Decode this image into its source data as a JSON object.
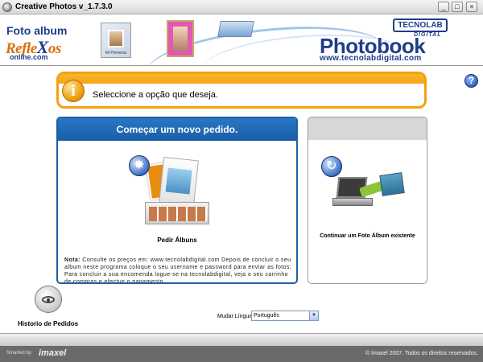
{
  "window": {
    "title": "Creative Photos v_1.7.3.0",
    "minimize_label": "_",
    "maximize_label": "□",
    "close_label": "×"
  },
  "header": {
    "logo_line1": "Foto album",
    "logo_line2_a": "Refle",
    "logo_line2_x": "X",
    "logo_line2_b": "os",
    "logo_line3": "online.com",
    "thumb1_caption": "Mi Primeras",
    "brand_title": "Photobook",
    "brand_url": "www.tecnolabdigital.com",
    "tecnolab_logo": "TECNOLAB",
    "tecnolab_sub": "DIGITAL"
  },
  "help": {
    "label": "?"
  },
  "info": {
    "icon_glyph": "i",
    "message": "Seleccione a opção que deseja."
  },
  "new_order": {
    "title": "Começar um novo pedido.",
    "action_label": "Pedir Álbuns",
    "note_bold": "Nota:",
    "note_text": " Consulte os preços em: www.tecnolabdigital.com Depois de concluir o seu album neste programa coloque o seu username e password para enviar as fotos; Para concluir a sua encomenda logue-se na tecnolabdigital, veja o seu carrinho de compras e efectue o pagamento.",
    "icon_glyph": "✸"
  },
  "continue_album": {
    "label": "Continuar um Foto Álbum existente",
    "icon_glyph": "↻"
  },
  "history": {
    "label": "Historio de Pedidos"
  },
  "language": {
    "label": "Mudar Língua",
    "selected": "Português"
  },
  "footer": {
    "smarted_by": "Smarted by:",
    "imaxel": "imaxel",
    "copyright": "© Imaxel 2007. Todos os direitos reservados."
  }
}
